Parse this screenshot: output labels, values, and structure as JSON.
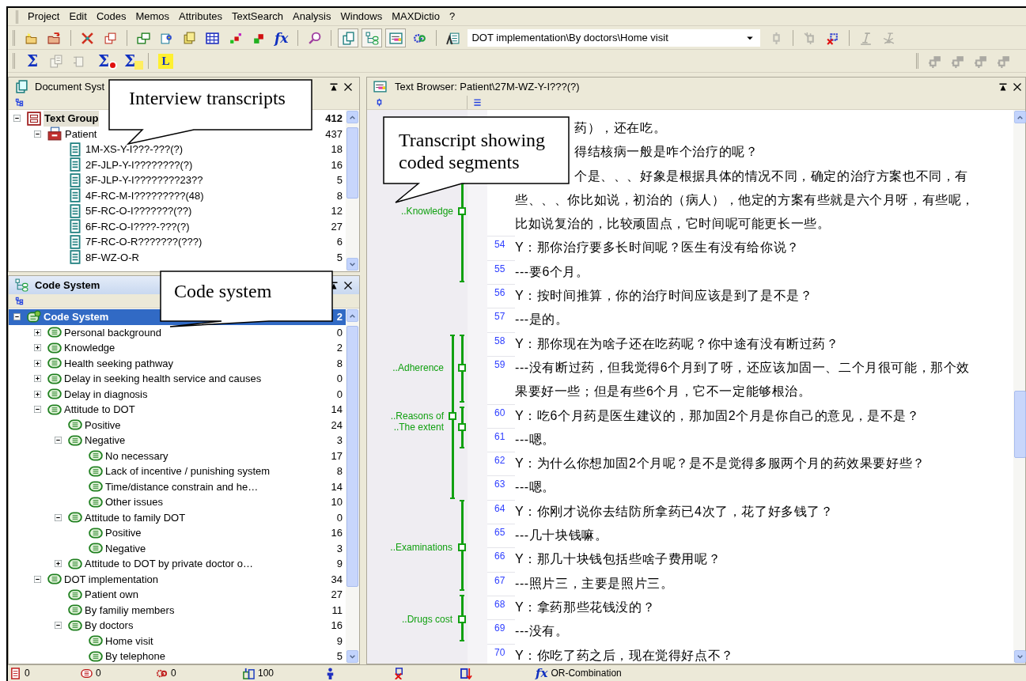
{
  "menu": [
    "Project",
    "Edit",
    "Codes",
    "Memos",
    "Attributes",
    "TextSearch",
    "Analysis",
    "Windows",
    "MAXDictio",
    "?"
  ],
  "toolbar_1": [
    {
      "kind": "icon",
      "disabled": false
    },
    {
      "kind": "icon",
      "disabled": false
    },
    {
      "kind": "separator"
    },
    {
      "kind": "icon",
      "disabled": false
    },
    {
      "kind": "icon",
      "disabled": false
    },
    {
      "kind": "separator"
    },
    {
      "kind": "icon",
      "disabled": false
    },
    {
      "kind": "icon",
      "disabled": false
    },
    {
      "kind": "icon",
      "disabled": false
    },
    {
      "kind": "icon",
      "disabled": false
    },
    {
      "kind": "icon",
      "disabled": false
    },
    {
      "kind": "icon",
      "disabled": false
    },
    {
      "kind": "glyph",
      "text": "fx"
    },
    {
      "kind": "separator"
    },
    {
      "kind": "icon",
      "disabled": false
    },
    {
      "kind": "separator"
    },
    {
      "kind": "toggle",
      "pressed": true
    },
    {
      "kind": "toggle",
      "pressed": true
    },
    {
      "kind": "toggle",
      "pressed": true
    },
    {
      "kind": "toggle",
      "pressed": false
    },
    {
      "kind": "separator"
    },
    {
      "kind": "icon",
      "disabled": false
    },
    {
      "kind": "combo",
      "value": "DOT implementation\\By doctors\\Home visit"
    },
    {
      "kind": "icon",
      "disabled": true
    },
    {
      "kind": "separator"
    },
    {
      "kind": "icon",
      "disabled": true
    },
    {
      "kind": "icon",
      "disabled": false
    },
    {
      "kind": "separator"
    },
    {
      "kind": "icon",
      "disabled": true
    },
    {
      "kind": "icon",
      "disabled": true
    }
  ],
  "toolbar_2": [
    {
      "kind": "glyph",
      "text": "Σ"
    },
    {
      "kind": "icon",
      "disabled": true
    },
    {
      "kind": "icon",
      "disabled": true
    },
    {
      "kind": "stopsum",
      "text": "Σ"
    },
    {
      "kind": "notesum",
      "text": "Σ"
    },
    {
      "kind": "separator"
    },
    {
      "kind": "label",
      "text": "L"
    }
  ],
  "toolbar_2_right": [
    {
      "kind": "icon",
      "disabled": true
    },
    {
      "kind": "icon",
      "disabled": true
    },
    {
      "kind": "icon",
      "disabled": true
    },
    {
      "kind": "icon",
      "disabled": true
    }
  ],
  "document_system": {
    "title": "Document Syst",
    "active": false,
    "tree": [
      {
        "kind": "group",
        "label": "Text Group",
        "count": "412",
        "expanded": true,
        "selected": true,
        "children": [
          {
            "kind": "set",
            "label": "Patient",
            "count": "437",
            "expanded": true,
            "selected": false,
            "children": [
              {
                "kind": "document",
                "label": "1M-XS-Y-I???-???(?)",
                "count": "18",
                "selected": false
              },
              {
                "kind": "document",
                "label": "2F-JLP-Y-I????????(?)",
                "count": "16",
                "selected": false
              },
              {
                "kind": "document",
                "label": "3F-JLP-Y-I????????23??",
                "count": "5",
                "selected": false
              },
              {
                "kind": "document",
                "label": "4F-RC-M-I?????????(48)",
                "count": "8",
                "selected": false
              },
              {
                "kind": "document",
                "label": "5F-RC-O-I???????(??)",
                "count": "12",
                "selected": false
              },
              {
                "kind": "document",
                "label": "6F-RC-O-I????-???(?)",
                "count": "27",
                "selected": false
              },
              {
                "kind": "document",
                "label": "7F-RC-O-R???????(???)",
                "count": "6",
                "selected": false
              },
              {
                "kind": "document",
                "label": "8F-WZ-O-R",
                "count": "5",
                "selected": false
              }
            ]
          }
        ]
      }
    ]
  },
  "code_system": {
    "title": "Code System",
    "active": true,
    "tree": [
      {
        "kind": "root",
        "label": "Code System",
        "count": "2",
        "expanded": true,
        "selected": true,
        "children": [
          {
            "kind": "code",
            "label": "Personal background",
            "count": "0",
            "expanded": false,
            "selected": false
          },
          {
            "kind": "code",
            "label": "Knowledge",
            "count": "2",
            "expanded": false,
            "selected": false
          },
          {
            "kind": "code",
            "label": "Health seeking pathway",
            "count": "8",
            "expanded": false,
            "selected": false
          },
          {
            "kind": "code",
            "label": "Delay in seeking health service and causes",
            "count": "0",
            "expanded": false,
            "selected": false
          },
          {
            "kind": "code",
            "label": "Delay in diagnosis",
            "count": "0",
            "expanded": false,
            "selected": false
          },
          {
            "kind": "code",
            "label": "Attitude to DOT",
            "count": "14",
            "expanded": true,
            "selected": false,
            "children": [
              {
                "kind": "code",
                "label": "Positive",
                "count": "24",
                "selected": false
              },
              {
                "kind": "code",
                "label": "Negative",
                "count": "3",
                "expanded": true,
                "selected": false,
                "children": [
                  {
                    "kind": "code",
                    "label": "No necessary",
                    "count": "17",
                    "selected": false
                  },
                  {
                    "kind": "code",
                    "label": "Lack of incentive / punishing system",
                    "count": "8",
                    "selected": false
                  },
                  {
                    "kind": "code",
                    "label": "Time/distance constrain and he…",
                    "count": "14",
                    "selected": false
                  },
                  {
                    "kind": "code",
                    "label": "Other issues",
                    "count": "10",
                    "selected": false
                  }
                ]
              },
              {
                "kind": "code",
                "label": "Attitude to family DOT",
                "count": "0",
                "expanded": true,
                "selected": false,
                "children": [
                  {
                    "kind": "code",
                    "label": "Positive",
                    "count": "16",
                    "selected": false
                  },
                  {
                    "kind": "code",
                    "label": "Negative",
                    "count": "3",
                    "selected": false
                  }
                ]
              },
              {
                "kind": "code",
                "label": "Attitude to DOT by private doctor o…",
                "count": "9",
                "expanded": false,
                "selected": false
              }
            ]
          },
          {
            "kind": "code",
            "label": "DOT implementation",
            "count": "34",
            "expanded": true,
            "selected": false,
            "children": [
              {
                "kind": "code",
                "label": "Patient own",
                "count": "27",
                "selected": false
              },
              {
                "kind": "code",
                "label": "By familiy members",
                "count": "11",
                "selected": false
              },
              {
                "kind": "code",
                "label": "By doctors",
                "count": "16",
                "expanded": true,
                "selected": false,
                "children": [
                  {
                    "kind": "code",
                    "label": "Home visit",
                    "count": "9",
                    "selected": false
                  },
                  {
                    "kind": "code",
                    "label": "By telephone",
                    "count": "5",
                    "selected": false
                  }
                ]
              }
            ]
          }
        ]
      }
    ]
  },
  "text_browser": {
    "title": "Text Browser: Patient\\27M-WZ-Y-I???(?)",
    "segments": [
      {
        "label": "..Knowledge"
      },
      {
        "label": "..Adherence"
      },
      {
        "label": "..Reasons of"
      },
      {
        "label": "..The extent"
      },
      {
        "label": "..Examinations"
      },
      {
        "label": "..Drugs cost"
      }
    ],
    "lines": [
      {
        "kind": "cut",
        "text": "药），还在吃。"
      },
      {
        "kind": "cut",
        "text": "得结核病一般是咋个治疗的呢？"
      },
      {
        "kind": "cut",
        "text": "个是、、、好象是根据具体的情况不同，确定的治疗方案也不同，有"
      },
      {
        "kind": "wrap",
        "text": "些、、、你比如说，初治的（病人），他定的方案有些就是六个月呀，有些呢，"
      },
      {
        "kind": "wrap",
        "text": "比如说复治的，比较顽固点，它时间呢可能更长一些。"
      },
      {
        "kind": "numbered",
        "number": "54",
        "text": "Y：那你治疗要多长时间呢？医生有没有给你说？"
      },
      {
        "kind": "numbered",
        "number": "55",
        "text": "---要6个月。"
      },
      {
        "kind": "numbered",
        "number": "56",
        "text": "Y：按时间推算，你的治疗时间应该是到了是不是？"
      },
      {
        "kind": "numbered",
        "number": "57",
        "text": "---是的。"
      },
      {
        "kind": "numbered",
        "number": "58",
        "text": "Y：那你现在为啥子还在吃药呢？你中途有没有断过药？"
      },
      {
        "kind": "numbered",
        "number": "59",
        "text": "---没有断过药，但我觉得6个月到了呀，还应该加固一、二个月很可能，那个效"
      },
      {
        "kind": "wrap",
        "text": "果要好一些；但是有些6个月，它不一定能够根治。"
      },
      {
        "kind": "numbered",
        "number": "60",
        "text": "Y：吃6个月药是医生建议的，那加固2个月是你自己的意见，是不是？"
      },
      {
        "kind": "numbered",
        "number": "61",
        "text": "---嗯。"
      },
      {
        "kind": "numbered",
        "number": "62",
        "text": "Y：为什么你想加固2个月呢？是不是觉得多服两个月的药效果要好些？"
      },
      {
        "kind": "numbered",
        "number": "63",
        "text": "---嗯。"
      },
      {
        "kind": "numbered",
        "number": "64",
        "text": "Y：你刚才说你去结防所拿药已4次了，花了好多钱了？"
      },
      {
        "kind": "numbered",
        "number": "65",
        "text": "---几十块钱嘛。"
      },
      {
        "kind": "numbered",
        "number": "66",
        "text": "Y：那几十块钱包括些啥子费用呢？"
      },
      {
        "kind": "numbered",
        "number": "67",
        "text": "---照片三，主要是照片三。"
      },
      {
        "kind": "numbered",
        "number": "68",
        "text": "Y：拿药那些花钱没的？"
      },
      {
        "kind": "numbered",
        "number": "69",
        "text": "---没有。"
      },
      {
        "kind": "numbered",
        "number": "70",
        "text": "Y：你吃了药之后，现在觉得好点不？"
      }
    ]
  },
  "callouts": [
    {
      "text": "Interview transcripts"
    },
    {
      "text": "Code system"
    },
    {
      "text": "Transcript showing coded segments"
    }
  ],
  "status_bar": [
    {
      "kind": "count",
      "text": "0"
    },
    {
      "kind": "count",
      "text": "0"
    },
    {
      "kind": "count",
      "text": "0"
    },
    {
      "kind": "count",
      "text": "100"
    },
    {
      "kind": "icon"
    },
    {
      "kind": "icon"
    },
    {
      "kind": "icon"
    },
    {
      "kind": "glyph",
      "glyph": "fx",
      "text": "OR-Combination"
    }
  ]
}
